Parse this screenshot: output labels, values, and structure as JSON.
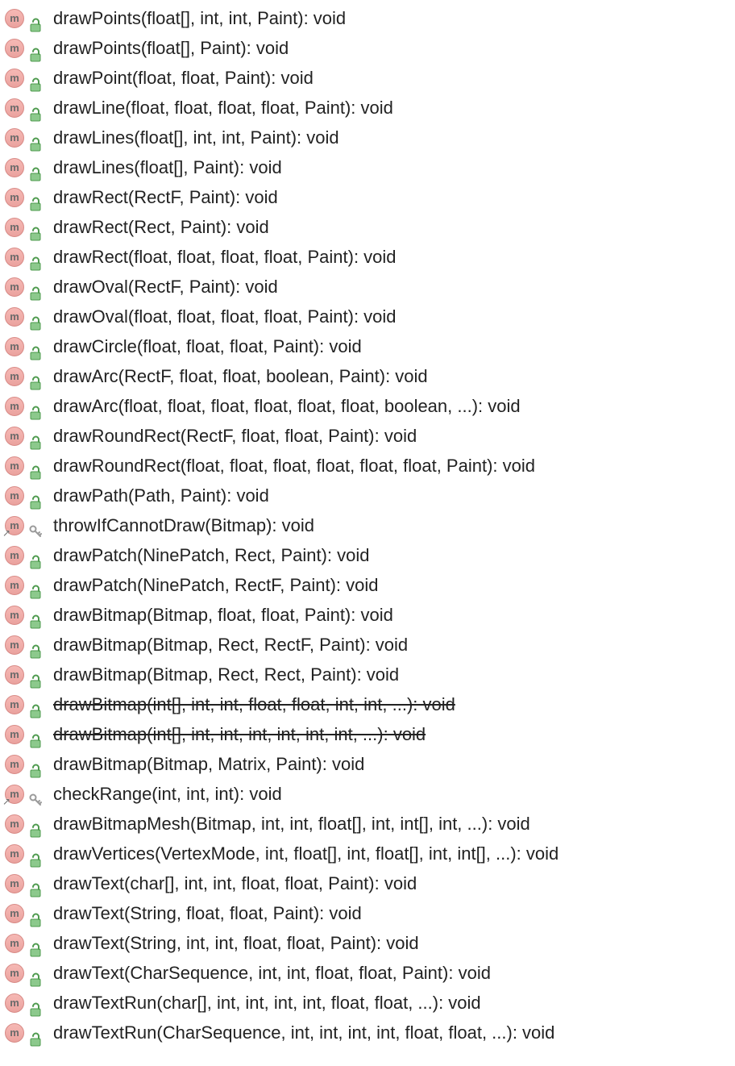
{
  "methods": [
    {
      "access": "public",
      "override": false,
      "deprecated": false,
      "signature": "drawPoints(float[], int, int, Paint): void"
    },
    {
      "access": "public",
      "override": false,
      "deprecated": false,
      "signature": "drawPoints(float[], Paint): void"
    },
    {
      "access": "public",
      "override": false,
      "deprecated": false,
      "signature": "drawPoint(float, float, Paint): void"
    },
    {
      "access": "public",
      "override": false,
      "deprecated": false,
      "signature": "drawLine(float, float, float, float, Paint): void"
    },
    {
      "access": "public",
      "override": false,
      "deprecated": false,
      "signature": "drawLines(float[], int, int, Paint): void"
    },
    {
      "access": "public",
      "override": false,
      "deprecated": false,
      "signature": "drawLines(float[], Paint): void"
    },
    {
      "access": "public",
      "override": false,
      "deprecated": false,
      "signature": "drawRect(RectF, Paint): void"
    },
    {
      "access": "public",
      "override": false,
      "deprecated": false,
      "signature": "drawRect(Rect, Paint): void"
    },
    {
      "access": "public",
      "override": false,
      "deprecated": false,
      "signature": "drawRect(float, float, float, float, Paint): void"
    },
    {
      "access": "public",
      "override": false,
      "deprecated": false,
      "signature": "drawOval(RectF, Paint): void"
    },
    {
      "access": "public",
      "override": false,
      "deprecated": false,
      "signature": "drawOval(float, float, float, float, Paint): void"
    },
    {
      "access": "public",
      "override": false,
      "deprecated": false,
      "signature": "drawCircle(float, float, float, Paint): void"
    },
    {
      "access": "public",
      "override": false,
      "deprecated": false,
      "signature": "drawArc(RectF, float, float, boolean, Paint): void"
    },
    {
      "access": "public",
      "override": false,
      "deprecated": false,
      "signature": "drawArc(float, float, float, float, float, float, boolean, ...): void"
    },
    {
      "access": "public",
      "override": false,
      "deprecated": false,
      "signature": "drawRoundRect(RectF, float, float, Paint): void"
    },
    {
      "access": "public",
      "override": false,
      "deprecated": false,
      "signature": "drawRoundRect(float, float, float, float, float, float, Paint): void"
    },
    {
      "access": "public",
      "override": false,
      "deprecated": false,
      "signature": "drawPath(Path, Paint): void"
    },
    {
      "access": "protected",
      "override": true,
      "deprecated": false,
      "signature": "throwIfCannotDraw(Bitmap): void"
    },
    {
      "access": "public",
      "override": false,
      "deprecated": false,
      "signature": "drawPatch(NinePatch, Rect, Paint): void"
    },
    {
      "access": "public",
      "override": false,
      "deprecated": false,
      "signature": "drawPatch(NinePatch, RectF, Paint): void"
    },
    {
      "access": "public",
      "override": false,
      "deprecated": false,
      "signature": "drawBitmap(Bitmap, float, float, Paint): void"
    },
    {
      "access": "public",
      "override": false,
      "deprecated": false,
      "signature": "drawBitmap(Bitmap, Rect, RectF, Paint): void"
    },
    {
      "access": "public",
      "override": false,
      "deprecated": false,
      "signature": "drawBitmap(Bitmap, Rect, Rect, Paint): void"
    },
    {
      "access": "public",
      "override": false,
      "deprecated": true,
      "signature": "drawBitmap(int[], int, int, float, float, int, int, ...): void"
    },
    {
      "access": "public",
      "override": false,
      "deprecated": true,
      "signature": "drawBitmap(int[], int, int, int, int, int, int, ...): void"
    },
    {
      "access": "public",
      "override": false,
      "deprecated": false,
      "signature": "drawBitmap(Bitmap, Matrix, Paint): void"
    },
    {
      "access": "protected",
      "override": true,
      "deprecated": false,
      "signature": "checkRange(int, int, int): void"
    },
    {
      "access": "public",
      "override": false,
      "deprecated": false,
      "signature": "drawBitmapMesh(Bitmap, int, int, float[], int, int[], int, ...): void"
    },
    {
      "access": "public",
      "override": false,
      "deprecated": false,
      "signature": "drawVertices(VertexMode, int, float[], int, float[], int, int[], ...): void"
    },
    {
      "access": "public",
      "override": false,
      "deprecated": false,
      "signature": "drawText(char[], int, int, float, float, Paint): void"
    },
    {
      "access": "public",
      "override": false,
      "deprecated": false,
      "signature": "drawText(String, float, float, Paint): void"
    },
    {
      "access": "public",
      "override": false,
      "deprecated": false,
      "signature": "drawText(String, int, int, float, float, Paint): void"
    },
    {
      "access": "public",
      "override": false,
      "deprecated": false,
      "signature": "drawText(CharSequence, int, int, float, float, Paint): void"
    },
    {
      "access": "public",
      "override": false,
      "deprecated": false,
      "signature": "drawTextRun(char[], int, int, int, int, float, float, ...): void"
    },
    {
      "access": "public",
      "override": false,
      "deprecated": false,
      "signature": "drawTextRun(CharSequence, int, int, int, int, float, float, ...): void"
    }
  ]
}
